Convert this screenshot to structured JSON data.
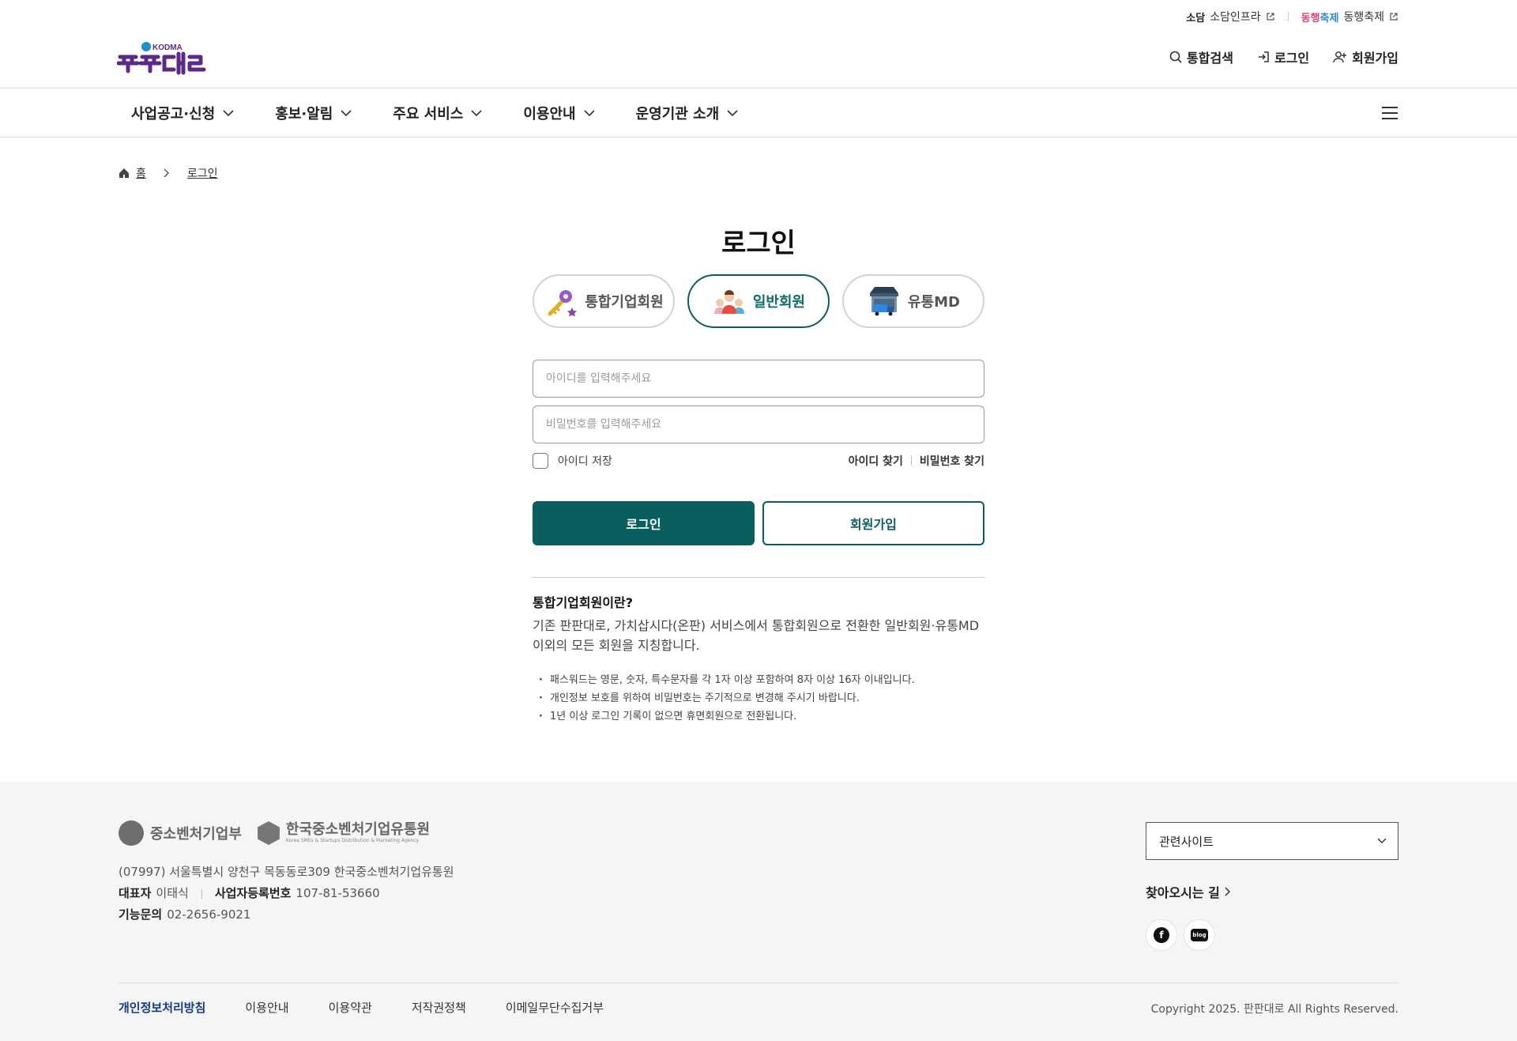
{
  "header": {
    "util_links": [
      {
        "logo": "소담",
        "label": "소담인프라"
      },
      {
        "logo_a": "동행",
        "logo_b": "축제",
        "label": "동행축제"
      }
    ],
    "member_links": {
      "search": "통합검색",
      "login": "로그인",
      "join": "회원가입"
    },
    "logo_text": "KODMA"
  },
  "gnb": {
    "items": [
      "사업공고·신청",
      "홍보·알림",
      "주요 서비스",
      "이용안내",
      "운영기관 소개"
    ]
  },
  "breadcrumb": {
    "home": "홈",
    "current": "로그인"
  },
  "login": {
    "title": "로그인",
    "tabs": [
      {
        "label": "통합기업회원",
        "icon": "key-icon",
        "active": false
      },
      {
        "label": "일반회원",
        "icon": "people-icon",
        "active": true
      },
      {
        "label": "유통MD",
        "icon": "store-truck-icon",
        "active": false
      }
    ],
    "id_placeholder": "아이디를 입력해주세요",
    "pw_placeholder": "비밀번호를 입력해주세요",
    "save_id": "아이디 저장",
    "find_id": "아이디 찾기",
    "find_pw": "비밀번호 찾기",
    "login_button": "로그인",
    "join_button": "회원가입",
    "info_title": "통합기업회원이란?",
    "info_desc_1": "기존 판판대로, 가치삽시다(온판) 서비스에서 통합회원으로 전환한 일반회원·유통MD",
    "info_desc_2": "이외의 모든 회원을 지칭합니다.",
    "notes": [
      "패스워드는 영문, 숫자, 특수문자를 각 1자 이상 포함하여 8자 이상 16자 이내입니다.",
      "개인정보 보호를 위하여 비밀번호는 주기적으로 변경해 주시기 바랍니다.",
      "1년 이상 로그인 기록이 없으면 휴면회원으로 전환됩니다."
    ],
    "accent_color": "#0b5e5e"
  },
  "footer": {
    "logo_mss": "중소벤처기업부",
    "logo_kodma": "한국중소벤처기업유통원",
    "logo_kodma_en": "Korea SMEs & Startups Distribution & Marketing Agency",
    "address": "(07997) 서울특별시 양천구 목동동로309 한국중소벤처기업유통원",
    "ceo_label": "대표자",
    "ceo": "이태식",
    "biz_label": "사업자등록번호",
    "biz_no": "107-81-53660",
    "tech_label": "기능문의",
    "tech_phone": "02-2656-9021",
    "related_select": "관련사이트",
    "directions": "찾아오시는 길",
    "sns": [
      "facebook-icon",
      "blog-icon"
    ],
    "sns_blog_text": "blog",
    "sns_fb_text": "f",
    "links": [
      "개인정보처리방침",
      "이용안내",
      "이용약관",
      "저작권정책",
      "이메일무단수집거부"
    ],
    "copyright": "Copyright 2025. 판판대로 All Rights Reserved."
  }
}
